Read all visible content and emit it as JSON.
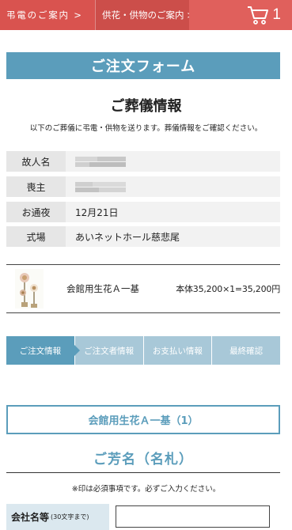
{
  "header": {
    "breadcrumb_1": "弔電のご案内 >",
    "breadcrumb_2": "供花・供物のご案内 >",
    "cart_count": "1"
  },
  "form": {
    "title": "ご注文フォーム"
  },
  "funeral_info": {
    "title": "ご葬儀情報",
    "description": "以下のご葬儀に弔電・供物を送ります。葬儀情報をご確認ください。",
    "rows": [
      {
        "label": "故人名",
        "value": ""
      },
      {
        "label": "喪主",
        "value": ""
      },
      {
        "label": "お通夜",
        "value": "12月21日"
      },
      {
        "label": "式場",
        "value": "あいネットホール慈悲尾"
      }
    ]
  },
  "product": {
    "name": "会館用生花Ａ一基",
    "price": "本体35,200×1=35,200円"
  },
  "steps": [
    "ご注文情報",
    "ご注文者情報",
    "お支払い情報",
    "最終確認"
  ],
  "item_box": {
    "label": "会館用生花Ａ一基（1）"
  },
  "name_section": {
    "title": "ご芳名（名札）",
    "required_note": "※印は必須事項です。必ずご入力ください。"
  },
  "company_field": {
    "label": "会社名等",
    "hint": "(30文字まで)",
    "value": ""
  },
  "colors": {
    "header_red": "#d9534f",
    "accent_blue": "#5b9dbb",
    "step_inactive": "#a8c8d8"
  }
}
